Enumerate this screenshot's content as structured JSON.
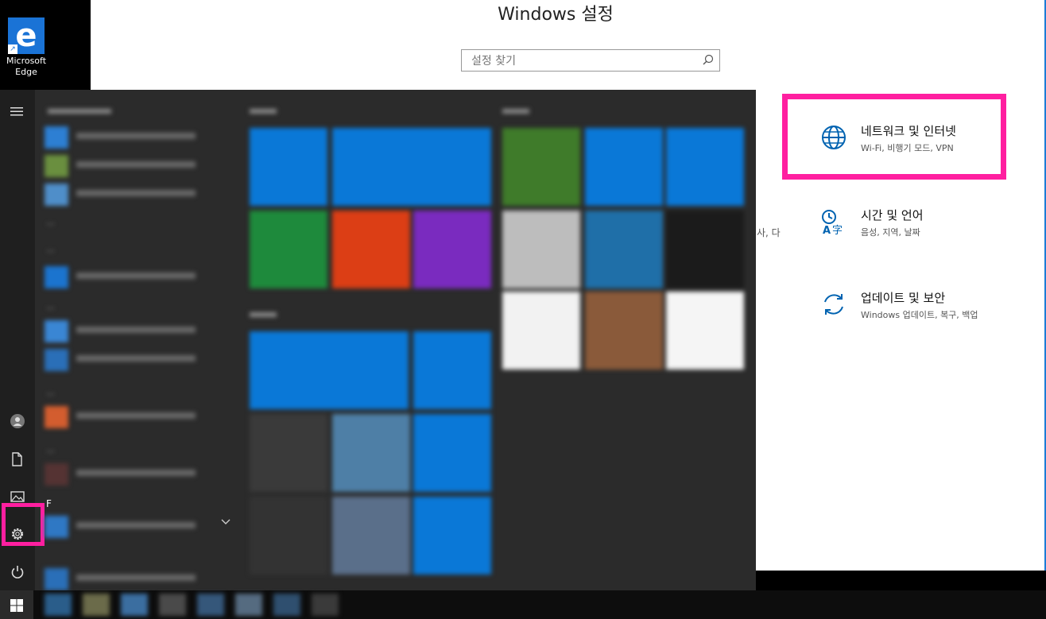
{
  "desktop": {
    "edge_shortcut_label": "Microsoft Edge",
    "edge_icon": "edge-logo-icon"
  },
  "settings": {
    "title": "Windows 설정",
    "search": {
      "placeholder": "설정 찾기",
      "icon": "search-icon"
    },
    "categories": [
      {
        "title": "네트워크 및 인터넷",
        "subtitle": "Wi-Fi, 비행기 모드, VPN",
        "icon": "globe-icon",
        "highlighted": true
      },
      {
        "title": "시간 및 언어",
        "subtitle": "음성, 지역, 날짜",
        "icon": "time-language-icon",
        "highlighted": false
      },
      {
        "title": "업데이트 및 보안",
        "subtitle": "Windows 업데이트, 복구, 백업",
        "icon": "sync-arrows-icon",
        "highlighted": false
      }
    ],
    "truncated_text": "사, 다",
    "highlight_color": "#ff1fa0",
    "accent_color": "#0063b1"
  },
  "start_menu": {
    "rail": [
      "hamburger-icon",
      "user-icon",
      "documents-icon",
      "pictures-icon",
      "gear-icon",
      "power-icon"
    ],
    "settings_button_highlighted": true,
    "list_section_letter": "F",
    "list_blurred": true,
    "tiles_blurred": true
  },
  "taskbar": {
    "start_icon": "windows-logo-icon"
  }
}
